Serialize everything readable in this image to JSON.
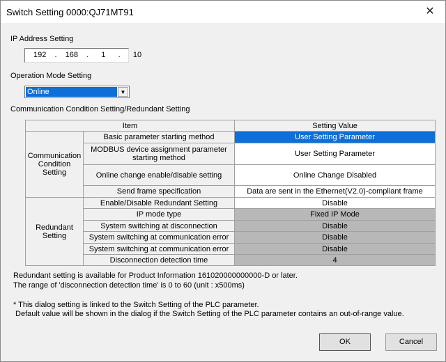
{
  "window": {
    "title": "Switch Setting 0000:QJ71MT91",
    "close_icon": "close-icon"
  },
  "ip": {
    "label": "IP Address Setting",
    "value": "192  .  168  .   1   .   10"
  },
  "mode": {
    "label": "Operation Mode Setting",
    "selected": "Online"
  },
  "section_label": "Communication Condition Setting/Redundant Setting",
  "table": {
    "headers": [
      "Item",
      "Setting Value"
    ],
    "groups": [
      "Communication Condition Setting",
      "Redundant Setting"
    ],
    "rows": [
      {
        "item": "Basic parameter starting method",
        "value": "User Setting Parameter"
      },
      {
        "item": "MODBUS device assignment parameter starting method",
        "value": "User Setting Parameter"
      },
      {
        "item": "Online change enable/disable setting",
        "value": "Online Change Disabled"
      },
      {
        "item": "Send frame specification",
        "value": "Data are sent in the Ethernet(V2.0)-compliant frame"
      },
      {
        "item": "Enable/Disable Redundant Setting",
        "value": "Disable"
      },
      {
        "item": "IP mode type",
        "value": "Fixed IP Mode"
      },
      {
        "item": "System switching at disconnection",
        "value": "Disable"
      },
      {
        "item": "System switching at communication error",
        "value": "Disable"
      },
      {
        "item": "System switching at communication error",
        "value": "Disable"
      },
      {
        "item": "Disconnection detection time",
        "value": "4"
      }
    ]
  },
  "notes": [
    "Redundant setting is available for Product Information 161020000000000-D or later.",
    "The range of 'disconnection detection time' is 0 to 60 (unit : x500ms)",
    "* This dialog setting is linked to the Switch Setting of the PLC parameter.",
    " Default value will be shown in the dialog if the Switch Setting of the PLC parameter contains an out-of-range value."
  ],
  "buttons": {
    "ok": "OK",
    "cancel": "Cancel"
  },
  "colors": {
    "selection": "#0f6fd8",
    "disabled_cell": "#b8b8b8",
    "background": "#f0f0f0"
  }
}
